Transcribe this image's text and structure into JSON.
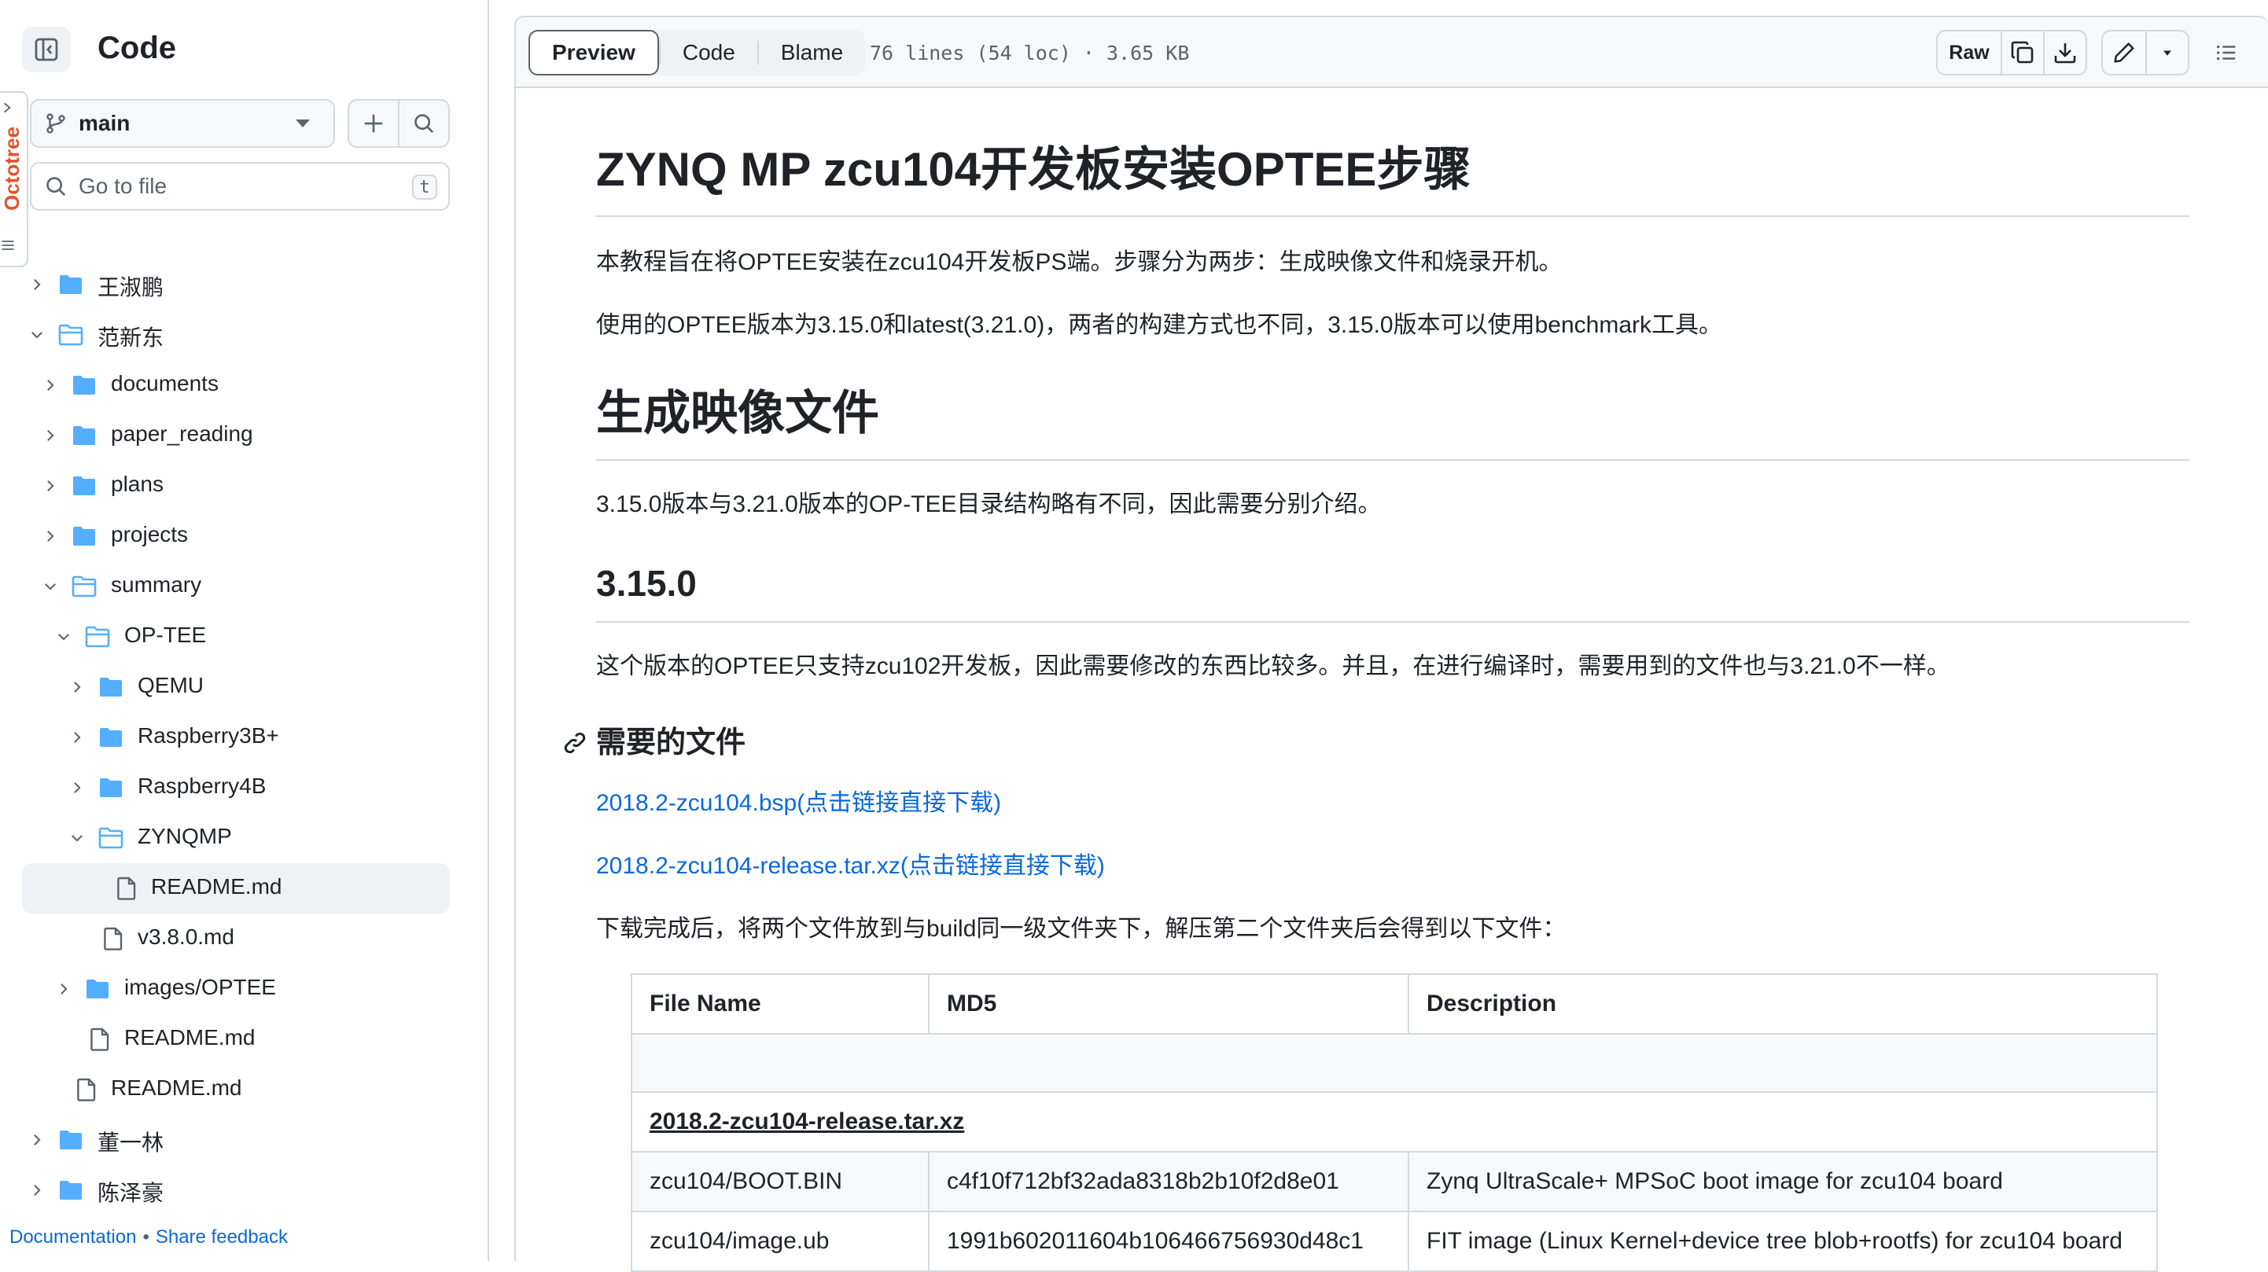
{
  "sidebar": {
    "title": "Code",
    "branch": "main",
    "goto_placeholder": "Go to file",
    "goto_shortcut": "t",
    "octotree_label": "Octotree",
    "tree": [
      {
        "label": "王淑鹏",
        "type": "folder",
        "depth": 0,
        "expanded": false
      },
      {
        "label": "范新东",
        "type": "folder",
        "depth": 0,
        "expanded": true
      },
      {
        "label": "documents",
        "type": "folder",
        "depth": 1,
        "expanded": false
      },
      {
        "label": "paper_reading",
        "type": "folder",
        "depth": 1,
        "expanded": false
      },
      {
        "label": "plans",
        "type": "folder",
        "depth": 1,
        "expanded": false
      },
      {
        "label": "projects",
        "type": "folder",
        "depth": 1,
        "expanded": false
      },
      {
        "label": "summary",
        "type": "folder",
        "depth": 1,
        "expanded": true
      },
      {
        "label": "OP-TEE",
        "type": "folder",
        "depth": 2,
        "expanded": true
      },
      {
        "label": "QEMU",
        "type": "folder",
        "depth": 3,
        "expanded": false
      },
      {
        "label": "Raspberry3B+",
        "type": "folder",
        "depth": 3,
        "expanded": false
      },
      {
        "label": "Raspberry4B",
        "type": "folder",
        "depth": 3,
        "expanded": false
      },
      {
        "label": "ZYNQMP",
        "type": "folder",
        "depth": 3,
        "expanded": true
      },
      {
        "label": "README.md",
        "type": "file",
        "depth": 4,
        "active": true
      },
      {
        "label": "v3.8.0.md",
        "type": "file",
        "depth": 3
      },
      {
        "label": "images/OPTEE",
        "type": "folder",
        "depth": 2,
        "expanded": false
      },
      {
        "label": "README.md",
        "type": "file",
        "depth": 2
      },
      {
        "label": "README.md",
        "type": "file",
        "depth": 1
      },
      {
        "label": "董一林",
        "type": "folder",
        "depth": 0,
        "expanded": false
      },
      {
        "label": "陈泽豪",
        "type": "folder",
        "depth": 0,
        "expanded": false
      }
    ],
    "footer": {
      "documentation": "Documentation",
      "separator": "•",
      "feedback": "Share feedback"
    }
  },
  "toolbar": {
    "tabs": [
      "Preview",
      "Code",
      "Blame"
    ],
    "selected_tab": "Preview",
    "file_info": "76 lines (54 loc) · 3.65 KB",
    "raw_label": "Raw"
  },
  "doc": {
    "title": "ZYNQ MP zcu104开发板安装OPTEE步骤",
    "intro1": "本教程旨在将OPTEE安装在zcu104开发板PS端。步骤分为两步：生成映像文件和烧录开机。",
    "intro2": "使用的OPTEE版本为3.15.0和latest(3.21.0)，两者的构建方式也不同，3.15.0版本可以使用benchmark工具。",
    "section1": "生成映像文件",
    "section1_p": "3.15.0版本与3.21.0版本的OP-TEE目录结构略有不同，因此需要分别介绍。",
    "sub1": "3.15.0",
    "sub1_p": "这个版本的OPTEE只支持zcu102开发板，因此需要修改的东西比较多。并且，在进行编译时，需要用到的文件也与3.21.0不一样。",
    "needed_files": "需要的文件",
    "link1": "2018.2-zcu104.bsp(点击链接直接下载)",
    "link2": "2018.2-zcu104-release.tar.xz(点击链接直接下载)",
    "after_download": "下载完成后，将两个文件放到与build同一级文件夹下，解压第二个文件夹后会得到以下文件：",
    "table": {
      "headers": [
        "File Name",
        "MD5",
        "Description"
      ],
      "group_label": "2018.2-zcu104-release.tar.xz",
      "rows": [
        [
          "zcu104/BOOT.BIN",
          "c4f10f712bf32ada8318b2b10f2d8e01",
          "Zynq UltraScale+ MPSoC boot image for zcu104 board"
        ],
        [
          "zcu104/image.ub",
          "1991b602011604b106466756930d48c1",
          "FIT image (Linux Kernel+device tree blob+rootfs) for zcu104 board"
        ]
      ]
    }
  },
  "colors": {
    "accent": "#0969da",
    "folder": "#54aeff",
    "border": "#d1d9e0",
    "octotree": "#e2532d"
  }
}
